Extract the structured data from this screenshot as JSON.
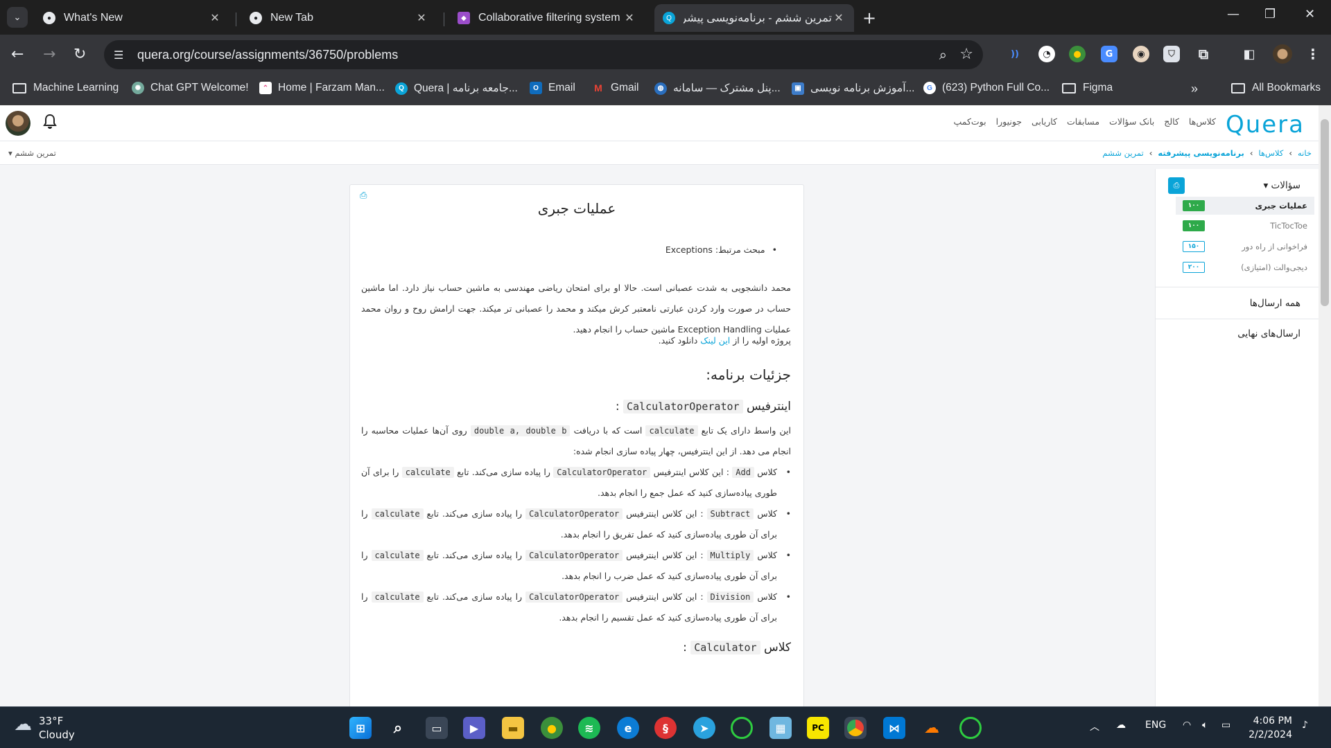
{
  "browser": {
    "tabs": [
      {
        "title": "What's New",
        "active": false
      },
      {
        "title": "New Tab",
        "active": false
      },
      {
        "title": "Collaborative filtering system | C",
        "active": false
      },
      {
        "title": "تمرین ششم - برنامه‌نویسی پیشرفته",
        "active": true
      }
    ],
    "url": "quera.org/course/assignments/36750/problems",
    "bookmarks": [
      {
        "label": "Machine Learning",
        "icon": "folder-icon"
      },
      {
        "label": "Chat GPT Welcome!",
        "icon": "chatgpt-icon"
      },
      {
        "label": "Home | Farzam Man...",
        "icon": "clickup-icon"
      },
      {
        "label": "Quera | جامعه برنامه...",
        "icon": "quera-icon"
      },
      {
        "label": "Email",
        "icon": "outlook-icon"
      },
      {
        "label": "Gmail",
        "icon": "gmail-icon"
      },
      {
        "label": "پنل مشترک — سامانه...",
        "icon": "globe-icon"
      },
      {
        "label": "آموزش برنامه نویسی...",
        "icon": "image-icon"
      },
      {
        "label": "(623) Python Full Co...",
        "icon": "google-icon"
      },
      {
        "label": "Figma",
        "icon": "folder-icon"
      }
    ],
    "all_bookmarks": "All Bookmarks"
  },
  "site": {
    "logo": "Quera",
    "nav": [
      "کلاس‌ها",
      "کالج",
      "بانک سؤالات",
      "مسابقات",
      "کاریابی",
      "جونیورا",
      "بوت‌کمپ"
    ],
    "breadcrumbs": [
      "خانه",
      "کلاس‌ها",
      "برنامه‌نویسی پیشرفته",
      "تمرین ششم"
    ],
    "assignment_selector": "تمرین ششم"
  },
  "problem": {
    "print_icon": "print-icon",
    "title": "عملیات جبری",
    "topic_label": "مبحث مرتبط:",
    "topic": "Exceptions",
    "intro": "محمد دانشجویی به شدت عصبانی است. حالا او برای امتحان ریاضی مهندسی به ماشین حساب نیاز دارد. اما ماشین حساب در صورت وارد کردن عبارتی نامعتبر کرش میکند و محمد را عصبانی تر میکند. جهت ارامش روح و روان محمد عملیات Exception Handling ماشین حساب را انجام دهید.",
    "download_before": "پروژه اولیه را از",
    "download_link": "این لینک",
    "download_after": "دانلود کنید.",
    "details_heading": "جزئیات برنامه:",
    "interface_word": "اینترفیس",
    "interface_name": "CalculatorOperator",
    "colon": ":",
    "iface_p1": "این واسط دارای یک تابع",
    "iface_fn": "calculate",
    "iface_p2": "است که با دریافت",
    "iface_args": "double a, double b",
    "iface_p3": "روی آن‌ها عملیات محاسبه را انجام می دهد. از این اینترفیس، چهار پیاده سازی انجام شده:",
    "classes": [
      {
        "cls_word": "کلاس",
        "name": "Add",
        "t1": ": این کلاس اینترفیس",
        "iface": "CalculatorOperator",
        "t2": "را پیاده سازی می‌کند. تابع",
        "fn": "calculate",
        "t3": "را برای آن طوری پیاده‌سازی کنید که عمل جمع را انجام بدهد."
      },
      {
        "cls_word": "کلاس",
        "name": "Subtract",
        "t1": ": این کلاس اینترفیس",
        "iface": "CalculatorOperator",
        "t2": "را پیاده سازی می‌کند. تابع",
        "fn": "calculate",
        "t3": "را برای آن طوری پیاده‌سازی کنید که عمل تفریق را انجام بدهد."
      },
      {
        "cls_word": "کلاس",
        "name": "Multiply",
        "t1": ": این کلاس اینترفیس",
        "iface": "CalculatorOperator",
        "t2": "را پیاده سازی می‌کند. تابع",
        "fn": "calculate",
        "t3": "را برای آن طوری پیاده‌سازی کنید که عمل ضرب را انجام بدهد."
      },
      {
        "cls_word": "کلاس",
        "name": "Division",
        "t1": ": این کلاس اینترفیس",
        "iface": "CalculatorOperator",
        "t2": "را پیاده سازی می‌کند. تابع",
        "fn": "calculate",
        "t3": "را برای آن طوری پیاده‌سازی کنید که عمل تقسیم را انجام بدهد."
      }
    ],
    "class_heading_word": "کلاس",
    "class_heading_name": "Calculator"
  },
  "sidebar": {
    "heading": "سؤالات",
    "problems": [
      {
        "name": "عملیات جبری",
        "score": "۱۰۰",
        "full": true,
        "active": true
      },
      {
        "name": "TicTocToe",
        "score": "۱۰۰",
        "full": true,
        "active": false
      },
      {
        "name": "فراخوانی از راه دور",
        "score": "۱۵۰",
        "full": false,
        "active": false
      },
      {
        "name": "دیجی‌والت (امتیازی)",
        "score": "۲۰۰",
        "full": false,
        "active": false
      }
    ],
    "all_submissions": "همه ارسال‌ها",
    "final_submissions": "ارسال‌های نهایی"
  },
  "taskbar": {
    "temperature": "33°F",
    "condition": "Cloudy",
    "language": "ENG",
    "time": "4:06 PM",
    "date": "2/2/2024"
  }
}
